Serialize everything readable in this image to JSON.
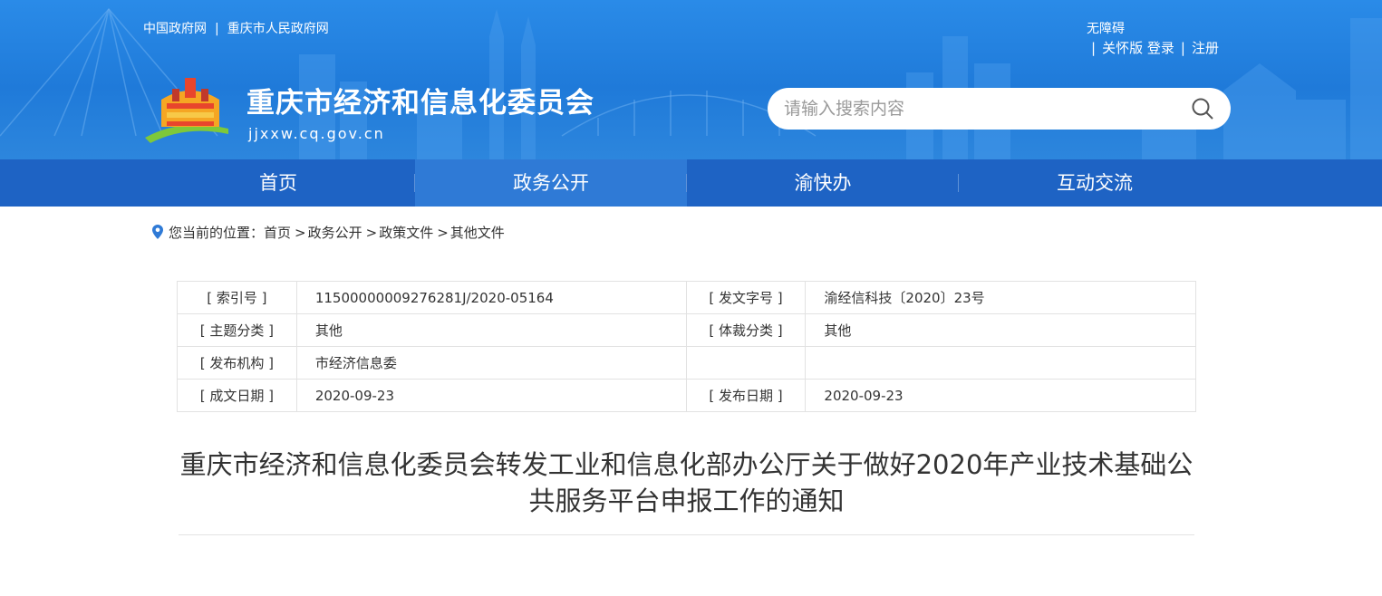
{
  "header": {
    "top_links": [
      "中国政府网",
      "重庆市人民政府网"
    ],
    "top_links_separator": "|",
    "accessibility": "无障碍",
    "user_links": [
      "关怀版",
      "登录",
      "注册"
    ],
    "user_links_separator": "|",
    "site_title": "重庆市经济和信息化委员会",
    "site_url": "jjxxw.cq.gov.cn",
    "search_placeholder": "请输入搜索内容",
    "search_icon": "search-icon",
    "colors": {
      "banner": "#1f7ad9",
      "nav": "#1e63c4",
      "nav_active": "#2f7ad6"
    }
  },
  "nav": {
    "items": [
      "首页",
      "政务公开",
      "渝快办",
      "互动交流"
    ],
    "active": "政务公开"
  },
  "breadcrumb": {
    "icon": "location-pin-icon",
    "prefix": "您当前的位置：",
    "items": [
      "首页",
      "政务公开",
      "政策文件",
      "其他文件"
    ],
    "separator": ">"
  },
  "meta": {
    "rows": [
      [
        "[ 索引号 ]",
        "11500000009276281J/2020-05164",
        "[ 发文字号 ]",
        "渝经信科技〔2020〕23号"
      ],
      [
        "[ 主题分类 ]",
        "其他",
        "[ 体裁分类 ]",
        "其他"
      ],
      [
        "[ 发布机构 ]",
        "市经济信息委",
        "",
        ""
      ],
      [
        "[ 成文日期 ]",
        "2020-09-23",
        "[ 发布日期 ]",
        "2020-09-23"
      ]
    ]
  },
  "document": {
    "title": "重庆市经济和信息化委员会转发工业和信息化部办公厅关于做好2020年产业技术基础公共服务平台申报工作的通知"
  }
}
